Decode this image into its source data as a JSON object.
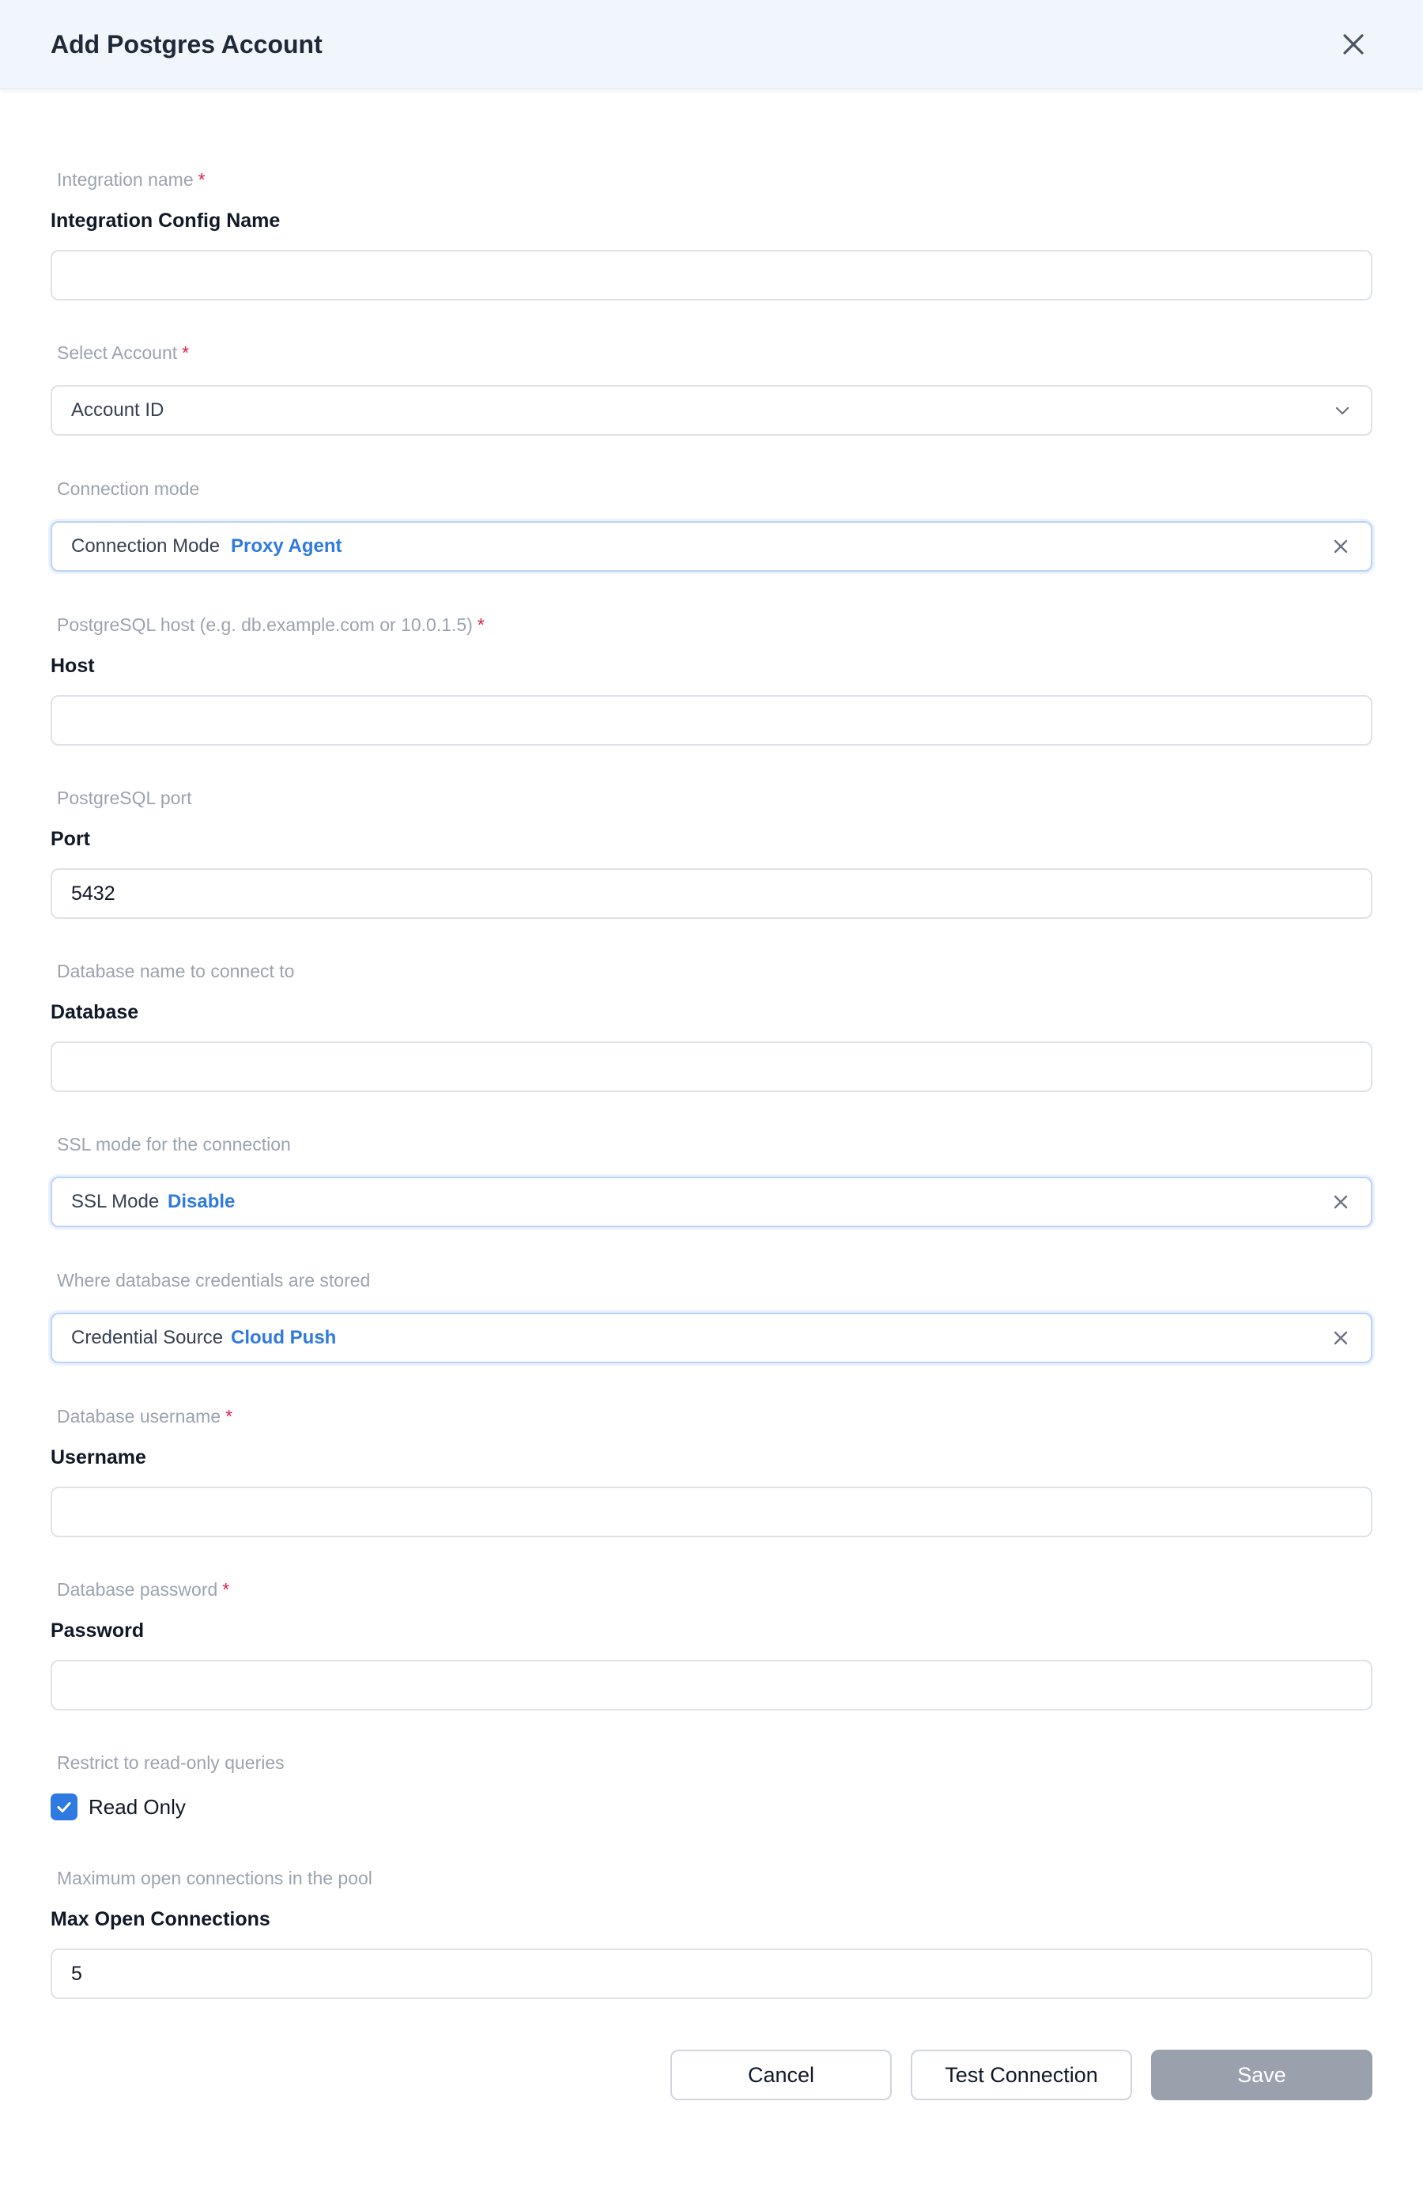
{
  "header": {
    "title": "Add Postgres Account"
  },
  "fields": {
    "integration_name": {
      "hint": "Integration name",
      "required_mark": "*",
      "label": "Integration Config Name",
      "value": "",
      "placeholder": ""
    },
    "account": {
      "hint": "Select Account",
      "required_mark": "*",
      "selected": "Account ID"
    },
    "connection_mode": {
      "hint": "Connection mode",
      "key": "Connection Mode",
      "value": "Proxy Agent"
    },
    "host": {
      "hint": "PostgreSQL host (e.g. db.example.com or 10.0.1.5)",
      "required_mark": "*",
      "label": "Host",
      "value": "",
      "placeholder": ""
    },
    "port": {
      "hint": "PostgreSQL port",
      "label": "Port",
      "value": "5432"
    },
    "database": {
      "hint": "Database name to connect to",
      "label": "Database",
      "value": "",
      "placeholder": ""
    },
    "ssl_mode": {
      "hint": "SSL mode for the connection",
      "key": "SSL Mode",
      "value": "Disable"
    },
    "credential_source": {
      "hint": "Where database credentials are stored",
      "key": "Credential Source",
      "value": "Cloud Push"
    },
    "username": {
      "hint": "Database username",
      "required_mark": "*",
      "label": "Username",
      "value": "",
      "placeholder": ""
    },
    "password": {
      "hint": "Database password",
      "required_mark": "*",
      "label": "Password",
      "value": "",
      "placeholder": ""
    },
    "read_only": {
      "hint": "Restrict to read-only queries",
      "label": "Read Only",
      "checked": true
    },
    "max_open_connections": {
      "hint": "Maximum open connections in the pool",
      "label": "Max Open Connections",
      "value": "5"
    }
  },
  "footer": {
    "cancel_label": "Cancel",
    "test_label": "Test Connection",
    "save_label": "Save"
  },
  "colors": {
    "accent": "#2f7ae0",
    "required": "#e11d48",
    "header_bg": "#f1f6fd",
    "save_disabled": "#9aa1ad"
  }
}
